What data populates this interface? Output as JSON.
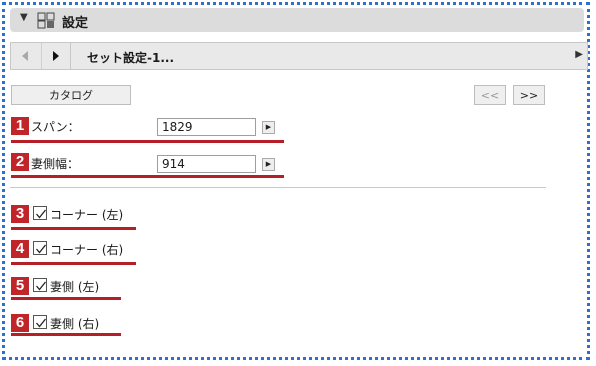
{
  "panel": {
    "title": "設定"
  },
  "nav": {
    "set_name": "セット設定-1..."
  },
  "buttons": {
    "catalog": "カタログ",
    "prev_set": "<<",
    "next_set": ">>"
  },
  "fields": [
    {
      "badge": "1",
      "label": "スパン：",
      "value": "1829"
    },
    {
      "badge": "2",
      "label": "妻側幅：",
      "value": "914"
    }
  ],
  "options": [
    {
      "badge": "3",
      "label": "コーナー (左)",
      "checked": true
    },
    {
      "badge": "4",
      "label": "コーナー (右)",
      "checked": true
    },
    {
      "badge": "5",
      "label": "妻側 (左)",
      "checked": true
    },
    {
      "badge": "6",
      "label": "妻側 (右)",
      "checked": true
    }
  ],
  "colors": {
    "accent_red": "#c0252a",
    "dotted_border": "#2f6fd0"
  },
  "icons": [
    "triangle-down-icon",
    "settings-panel-icon",
    "left-arrow-icon",
    "right-arrow-icon",
    "right-chevron-icon",
    "checkbox-check-icon"
  ]
}
